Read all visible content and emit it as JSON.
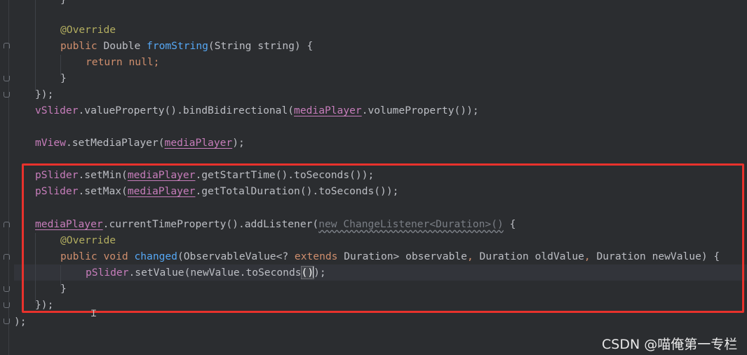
{
  "code": {
    "l0": "}",
    "l1_ann": "@Override",
    "l2_public": "public",
    "l2_type": "Double",
    "l2_fn": "fromString",
    "l2_rest": "(String string) {",
    "l3_return": "return",
    "l3_null": "null",
    "l3_semi": ";",
    "l4": "}",
    "l5": "});",
    "l6_field": "vSlider",
    "l6_a": ".valueProperty().bindBidirectional(",
    "l6_local": "mediaPlayer",
    "l6_b": ".volumeProperty());",
    "l8_field": "mView",
    "l8_a": ".setMediaPlayer(",
    "l8_local": "mediaPlayer",
    "l8_b": ");",
    "l10_field": "pSlider",
    "l10_a": ".setMin(",
    "l10_local": "mediaPlayer",
    "l10_b": ".getStartTime().toSeconds());",
    "l11_field": "pSlider",
    "l11_a": ".setMax(",
    "l11_local": "mediaPlayer",
    "l11_b": ".getTotalDuration().toSeconds());",
    "l13_local": "mediaPlayer",
    "l13_a": ".currentTimeProperty().addListener(",
    "l13_gray": "new ChangeListener<Duration>()",
    "l13_b": " {",
    "l14_ann": "@Override",
    "l15_public": "public",
    "l15_void": "void",
    "l15_fn": "changed",
    "l15_a": "(ObservableValue<? ",
    "l15_extends": "extends",
    "l15_b": " Duration> observable",
    "l15_c1": ",",
    "l15_d": " Duration oldValue",
    "l15_c2": ",",
    "l15_e": " Duration newValue) {",
    "l16_field": "pSlider",
    "l16_a": ".setValue(newValue.toSeconds",
    "l16_paren": "()",
    "l16_b": ");",
    "l17": "}",
    "l18": "});",
    "l19": ");"
  },
  "watermark": "CSDN @喵俺第一专栏",
  "colors": {
    "background": "#2b2d30",
    "keyword": "#cf8e6d",
    "annotation": "#b3ae60",
    "method": "#56a8f5",
    "field": "#c77dbb",
    "highlight_box": "#e8322c"
  }
}
